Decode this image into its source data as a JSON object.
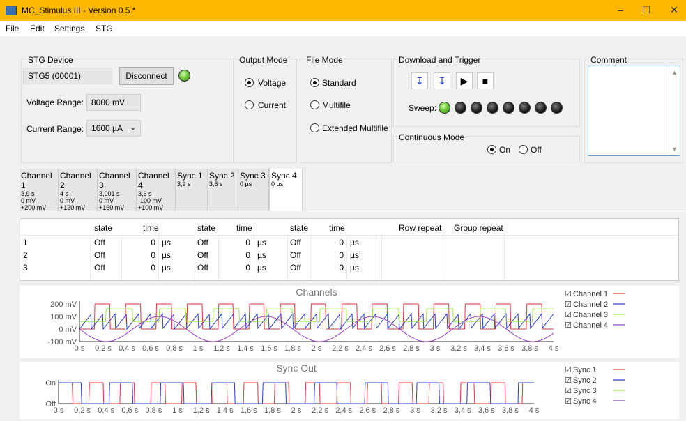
{
  "window": {
    "title": "MC_Stimulus III - Version 0.5 *"
  },
  "menu": [
    "File",
    "Edit",
    "Settings",
    "STG"
  ],
  "device": {
    "group": "STG Device",
    "name": "STG5 (00001)",
    "disconnect": "Disconnect",
    "voltage_label": "Voltage Range:",
    "voltage_value": "8000 mV",
    "current_label": "Current Range:",
    "current_value": "1600 µA"
  },
  "output_mode": {
    "group": "Output Mode",
    "options": [
      "Voltage",
      "Current"
    ],
    "selected": "Voltage"
  },
  "file_mode": {
    "group": "File Mode",
    "options": [
      "Standard",
      "Multifile",
      "Extended Multifile"
    ],
    "selected": "Standard"
  },
  "download": {
    "group": "Download and Trigger",
    "sweep_label": "Sweep:",
    "sweep_leds": [
      1,
      0,
      0,
      0,
      0,
      0,
      0,
      0
    ]
  },
  "continuous": {
    "group": "Continuous Mode",
    "options": [
      "On",
      "Off"
    ],
    "selected": "On"
  },
  "comment": {
    "group": "Comment"
  },
  "tabs": [
    {
      "name": "Channel 1",
      "l1": "3,9 s",
      "l2": "0 mV",
      "l3": "+200 mV"
    },
    {
      "name": "Channel 2",
      "l1": "4 s",
      "l2": "0 mV",
      "l3": "+120 mV"
    },
    {
      "name": "Channel 3",
      "l1": "3,001 s",
      "l2": "0 mV",
      "l3": "+160 mV"
    },
    {
      "name": "Channel 4",
      "l1": "3,6 s",
      "l2": "-100 mV",
      "l3": "+100 mV"
    },
    {
      "name": "Sync 1",
      "l1": "3,9 s",
      "l2": "",
      "l3": ""
    },
    {
      "name": "Sync 2",
      "l1": "3,6 s",
      "l2": "",
      "l3": ""
    },
    {
      "name": "Sync 3",
      "l1": "0 µs",
      "l2": "",
      "l3": ""
    },
    {
      "name": "Sync 4",
      "l1": "0 µs",
      "l2": "",
      "l3": ""
    }
  ],
  "table": {
    "headers": [
      "state",
      "time",
      "state",
      "time",
      "state",
      "time",
      "Row repeat",
      "Group repeat"
    ],
    "rows": [
      {
        "id": "1",
        "s1": "Off",
        "t1": "0",
        "u1": "µs",
        "s2": "Off",
        "t2": "0",
        "u2": "µs",
        "s3": "Off",
        "t3": "0",
        "u3": "µs"
      },
      {
        "id": "2",
        "s1": "Off",
        "t1": "0",
        "u1": "µs",
        "s2": "Off",
        "t2": "0",
        "u2": "µs",
        "s3": "Off",
        "t3": "0",
        "u3": "µs"
      },
      {
        "id": "3",
        "s1": "Off",
        "t1": "0",
        "u1": "µs",
        "s2": "Off",
        "t2": "0",
        "u2": "µs",
        "s3": "Off",
        "t3": "0",
        "u3": "µs"
      }
    ]
  },
  "colors": {
    "red": "#e8323c",
    "blue": "#2a3ccf",
    "green": "#9ae64a",
    "purple": "#9a3cc8",
    "accent": "#ffb800"
  },
  "chart_data": [
    {
      "type": "line",
      "title": "Channels",
      "y_tick_labels": [
        "200 mV",
        "100 mV",
        "0 mV",
        "-100 mV"
      ],
      "x_tick_labels": [
        "0 s",
        "0,2 s",
        "0,4 s",
        "0,6 s",
        "0,8 s",
        "1 s",
        "1,2 s",
        "1,4 s",
        "1,6 s",
        "1,8 s",
        "2 s",
        "2,2 s",
        "2,4 s",
        "2,6 s",
        "2,8 s",
        "3 s",
        "3,2 s",
        "3,4 s",
        "3,6 s",
        "3,8 s",
        "4 s"
      ],
      "xlim": [
        0,
        4
      ],
      "ylim": [
        -100,
        200
      ],
      "series": [
        {
          "name": "Channel 1",
          "color": "#e8323c",
          "shape": "square",
          "period": 0.26,
          "low": 0,
          "high": 200
        },
        {
          "name": "Channel 2",
          "color": "#2a3ccf",
          "shape": "sawtooth",
          "period": 0.1,
          "low": 0,
          "high": 120
        },
        {
          "name": "Channel 3",
          "color": "#9ae64a",
          "shape": "square",
          "period": 0.45,
          "low": 60,
          "high": 160
        },
        {
          "name": "Channel 4",
          "color": "#9a3cc8",
          "shape": "sine",
          "period": 0.9,
          "low": -100,
          "high": 100
        }
      ]
    },
    {
      "type": "line",
      "title": "Sync Out",
      "y_tick_labels": [
        "On",
        "Off"
      ],
      "x_tick_labels": [
        "0 s",
        "0,2 s",
        "0,4 s",
        "0,6 s",
        "0,8 s",
        "1 s",
        "1,2 s",
        "1,4 s",
        "1,6 s",
        "1,8 s",
        "2 s",
        "2,2 s",
        "2,4 s",
        "2,6 s",
        "2,8 s",
        "3 s",
        "3,2 s",
        "3,4 s",
        "3,6 s",
        "3,8 s",
        "4 s"
      ],
      "xlim": [
        0,
        4
      ],
      "series": [
        {
          "name": "Sync 1",
          "color": "#e8323c",
          "period": 0.26
        },
        {
          "name": "Sync 2",
          "color": "#2a3ccf",
          "period": 0.43
        },
        {
          "name": "Sync 3",
          "color": "#9ae64a"
        },
        {
          "name": "Sync 4",
          "color": "#9a3cc8"
        }
      ]
    }
  ]
}
